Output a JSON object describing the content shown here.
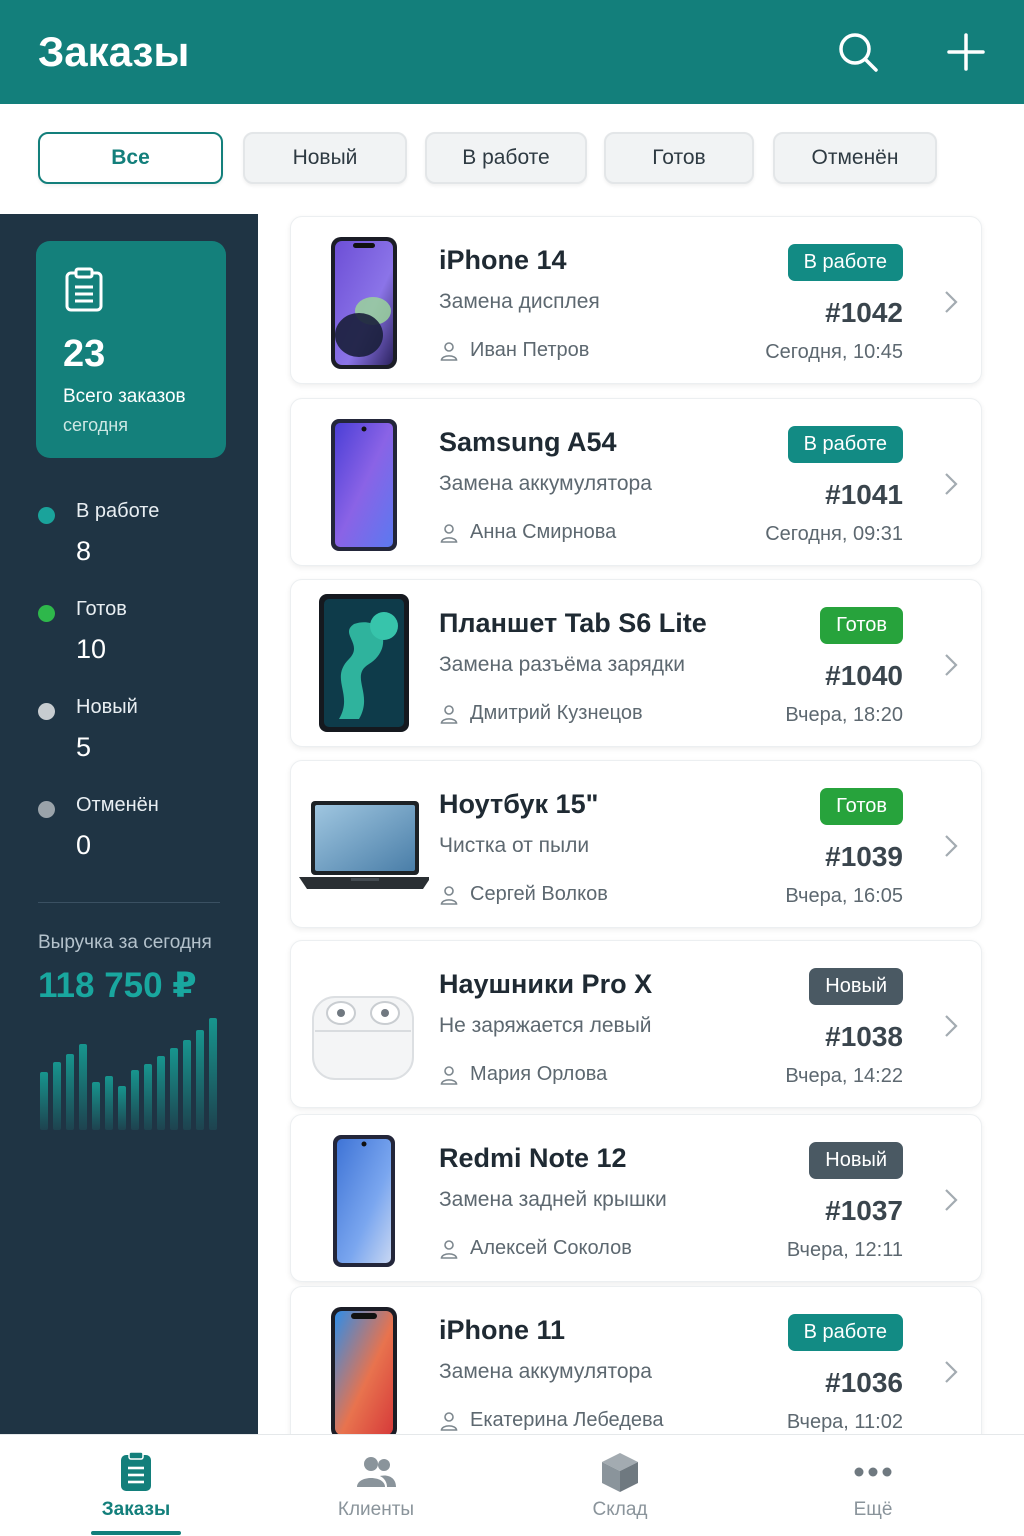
{
  "header": {
    "title": "Заказы",
    "search_icon": "search-icon",
    "add_icon": "plus-icon",
    "color": "#137f7b"
  },
  "filters": [
    {
      "label": "Все",
      "active": true
    },
    {
      "label": "Новый",
      "active": false
    },
    {
      "label": "В работе",
      "active": false
    },
    {
      "label": "Готов",
      "active": false
    },
    {
      "label": "Отменён",
      "active": false
    }
  ],
  "sidebar": {
    "total": {
      "value": "23",
      "label": "Всего заказов",
      "sublabel": "сегодня",
      "icon": "clipboard-icon"
    },
    "stats": [
      {
        "label": "В работе",
        "value": "8",
        "color": "#1aa39b"
      },
      {
        "label": "Готов",
        "value": "10",
        "color": "#2eb84b"
      },
      {
        "label": "Новый",
        "value": "5",
        "color": "#c7ccd0"
      },
      {
        "label": "Отменён",
        "value": "0",
        "color": "#9aa3aa"
      }
    ],
    "revenue": {
      "label": "Выручка за сегодня",
      "value": "118 750 ₽",
      "color": "#19a79f"
    }
  },
  "status_colors": {
    "В работе": "#128b84",
    "Готов": "#27a33c",
    "Новый": "#4a5963"
  },
  "orders": [
    {
      "device": "iPhone 14",
      "service": "Замена дисплея",
      "customer": "Иван Петров",
      "status": "В работе",
      "number": "#1042",
      "time": "Сегодня, 10:45",
      "thumb": "phone-purple"
    },
    {
      "device": "Samsung A54",
      "service": "Замена аккумулятора",
      "customer": "Анна Смирнова",
      "status": "В работе",
      "number": "#1041",
      "time": "Сегодня, 09:31",
      "thumb": "phone-violet"
    },
    {
      "device": "Планшет Tab S6 Lite",
      "service": "Замена разъёма зарядки",
      "customer": "Дмитрий Кузнецов",
      "status": "Готов",
      "number": "#1040",
      "time": "Вчера, 18:20",
      "thumb": "tablet"
    },
    {
      "device": "Ноутбук 15\"",
      "service": "Чистка от пыли",
      "customer": "Сергей Волков",
      "status": "Готов",
      "number": "#1039",
      "time": "Вчера, 16:05",
      "thumb": "laptop"
    },
    {
      "device": "Наушники Pro X",
      "service": "Не заряжается левый",
      "customer": "Мария Орлова",
      "status": "Новый",
      "number": "#1038",
      "time": "Вчера, 14:22",
      "thumb": "earbuds"
    },
    {
      "device": "Redmi Note 12",
      "service": "Замена задней крышки",
      "customer": "Алексей Соколов",
      "status": "Новый",
      "number": "#1037",
      "time": "Вчера, 12:11",
      "thumb": "phone-blue"
    },
    {
      "device": "iPhone 11",
      "service": "Замена аккумулятора",
      "customer": "Екатерина Лебедева",
      "status": "В работе",
      "number": "#1036",
      "time": "Вчера, 11:02",
      "thumb": "phone-red"
    }
  ],
  "bottom_nav": [
    {
      "label": "Заказы",
      "icon": "clipboard-icon",
      "active": true
    },
    {
      "label": "Клиенты",
      "icon": "users-icon",
      "active": false
    },
    {
      "label": "Склад",
      "icon": "box-icon",
      "active": false
    },
    {
      "label": "Ещё",
      "icon": "more-icon",
      "active": false
    }
  ]
}
